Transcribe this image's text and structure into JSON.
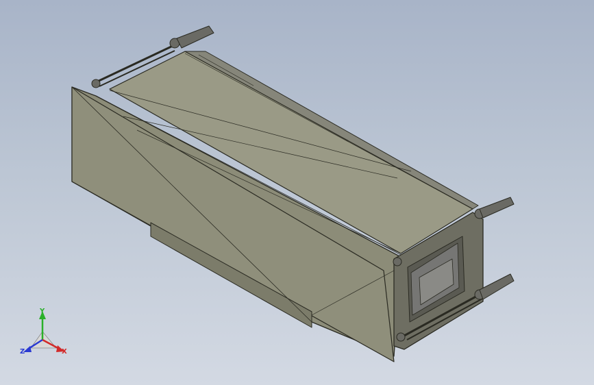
{
  "viewport": {
    "background_top": "#a8b4c8",
    "background_bottom": "#d3d9e3",
    "model_face_color": "#8c8c78",
    "model_edge_color": "#2a2a22"
  },
  "triad": {
    "x_label": "X",
    "y_label": "Y",
    "z_label": "Z",
    "x_color": "#d22a2a",
    "y_color": "#2ab02a",
    "z_color": "#2a3ad2"
  }
}
